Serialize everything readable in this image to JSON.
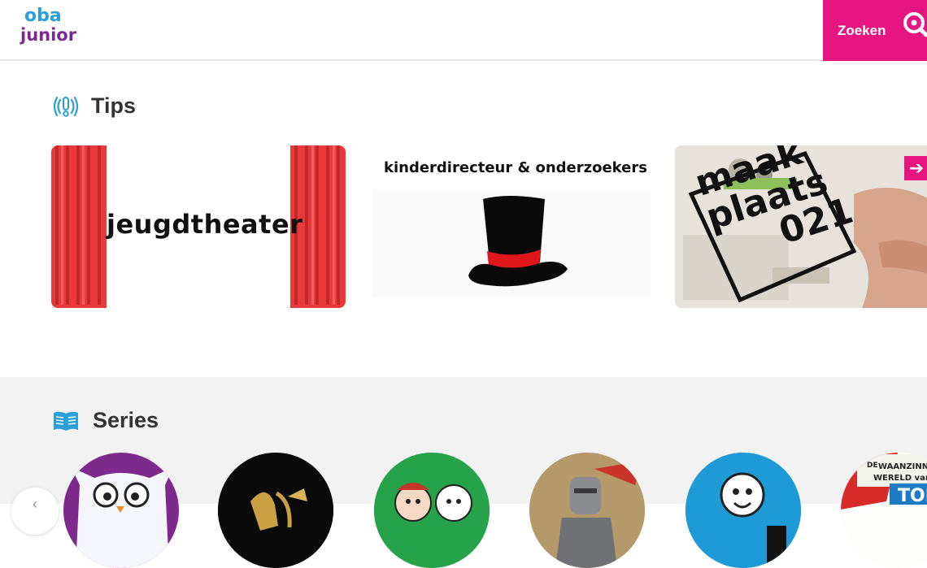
{
  "header": {
    "logo_top": "oba",
    "logo_bottom": "junior",
    "search_label": "Zoeken",
    "search_icon": "magnifier-icon"
  },
  "tips": {
    "title": "Tips",
    "icon": "broadcast-icon",
    "cards": [
      {
        "label": "jeugdtheater"
      },
      {
        "label": "kinderdirecteur & onderzoekers"
      },
      {
        "label_lines": [
          "maak",
          "plaats",
          "021"
        ]
      }
    ],
    "next_icon": "arrow-right-icon"
  },
  "series": {
    "title": "Series",
    "icon": "open-book-icon",
    "items": [
      {
        "name": ""
      },
      {
        "name": ""
      },
      {
        "name": ""
      },
      {
        "name": ""
      },
      {
        "name": ""
      },
      {
        "banner_lines": [
          "DE",
          "WAANZINNIGE",
          "WERELD van",
          "TOM"
        ]
      }
    ],
    "prev_icon": "arrow-left-icon"
  },
  "colors": {
    "brand_pink": "#e6157f",
    "curtain_red": "#e8393b",
    "title_text": "#333333",
    "icon_blue": "#2a9fd8"
  }
}
